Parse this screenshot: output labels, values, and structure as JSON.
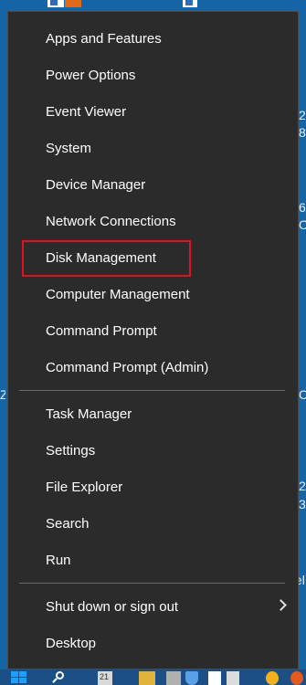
{
  "menu": {
    "group1": [
      {
        "label": "Apps and Features"
      },
      {
        "label": "Power Options"
      },
      {
        "label": "Event Viewer"
      },
      {
        "label": "System"
      },
      {
        "label": "Device Manager"
      },
      {
        "label": "Network Connections"
      },
      {
        "label": "Disk Management",
        "highlighted": true
      },
      {
        "label": "Computer Management"
      },
      {
        "label": "Command Prompt"
      },
      {
        "label": "Command Prompt (Admin)"
      }
    ],
    "group2": [
      {
        "label": "Task Manager"
      },
      {
        "label": "Settings"
      },
      {
        "label": "File Explorer"
      },
      {
        "label": "Search"
      },
      {
        "label": "Run"
      }
    ],
    "group3": [
      {
        "label": "Shut down or sign out",
        "submenu": true,
        "icon": "chevron-right-icon"
      },
      {
        "label": "Desktop"
      }
    ]
  },
  "highlight_color": "#e0121d",
  "desktop_edge_text": [
    "2",
    "8",
    "6",
    "O",
    "C",
    "2",
    "3",
    "el"
  ],
  "desktop_left_text": [
    "Z"
  ],
  "taskbar": {
    "calendar_text": "21",
    "icons": [
      "windows-start-icon",
      "search-icon",
      "calendar-icon",
      "folder-icon",
      "app-icon",
      "shield-icon",
      "store-bag-icon",
      "scanner-icon",
      "chrome-icon",
      "firefox-icon"
    ]
  }
}
